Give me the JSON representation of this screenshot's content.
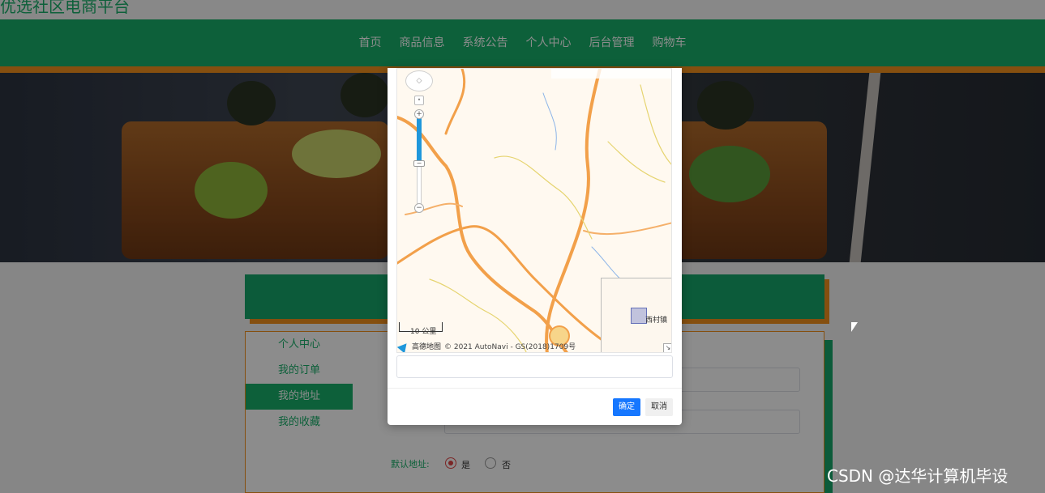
{
  "site": {
    "title": "优选社区电商平台"
  },
  "nav": {
    "items": [
      "首页",
      "商品信息",
      "系统公告",
      "个人中心",
      "后台管理",
      "购物车"
    ]
  },
  "side_menu": {
    "items": [
      "个人中心",
      "我的订单",
      "我的地址",
      "我的收藏"
    ],
    "active_index": 2
  },
  "form": {
    "default_address_label": "默认地址:",
    "options": [
      "是",
      "否"
    ],
    "selected": "是"
  },
  "map": {
    "scale_label": "10 公里",
    "brand": "高德地图",
    "copyright": "© 2021 AutoNavi - GS(2018)1709号",
    "overview_place": "西村镇",
    "zoom_in": "+",
    "zoom_out": "−"
  },
  "dialog": {
    "confirm_label": "确定",
    "cancel_label": "取消"
  },
  "watermark": "CSDN @达华计算机毕设",
  "colors": {
    "brand_green": "#18b06a",
    "accent_orange": "#f3901c",
    "primary_blue": "#1677ff"
  }
}
